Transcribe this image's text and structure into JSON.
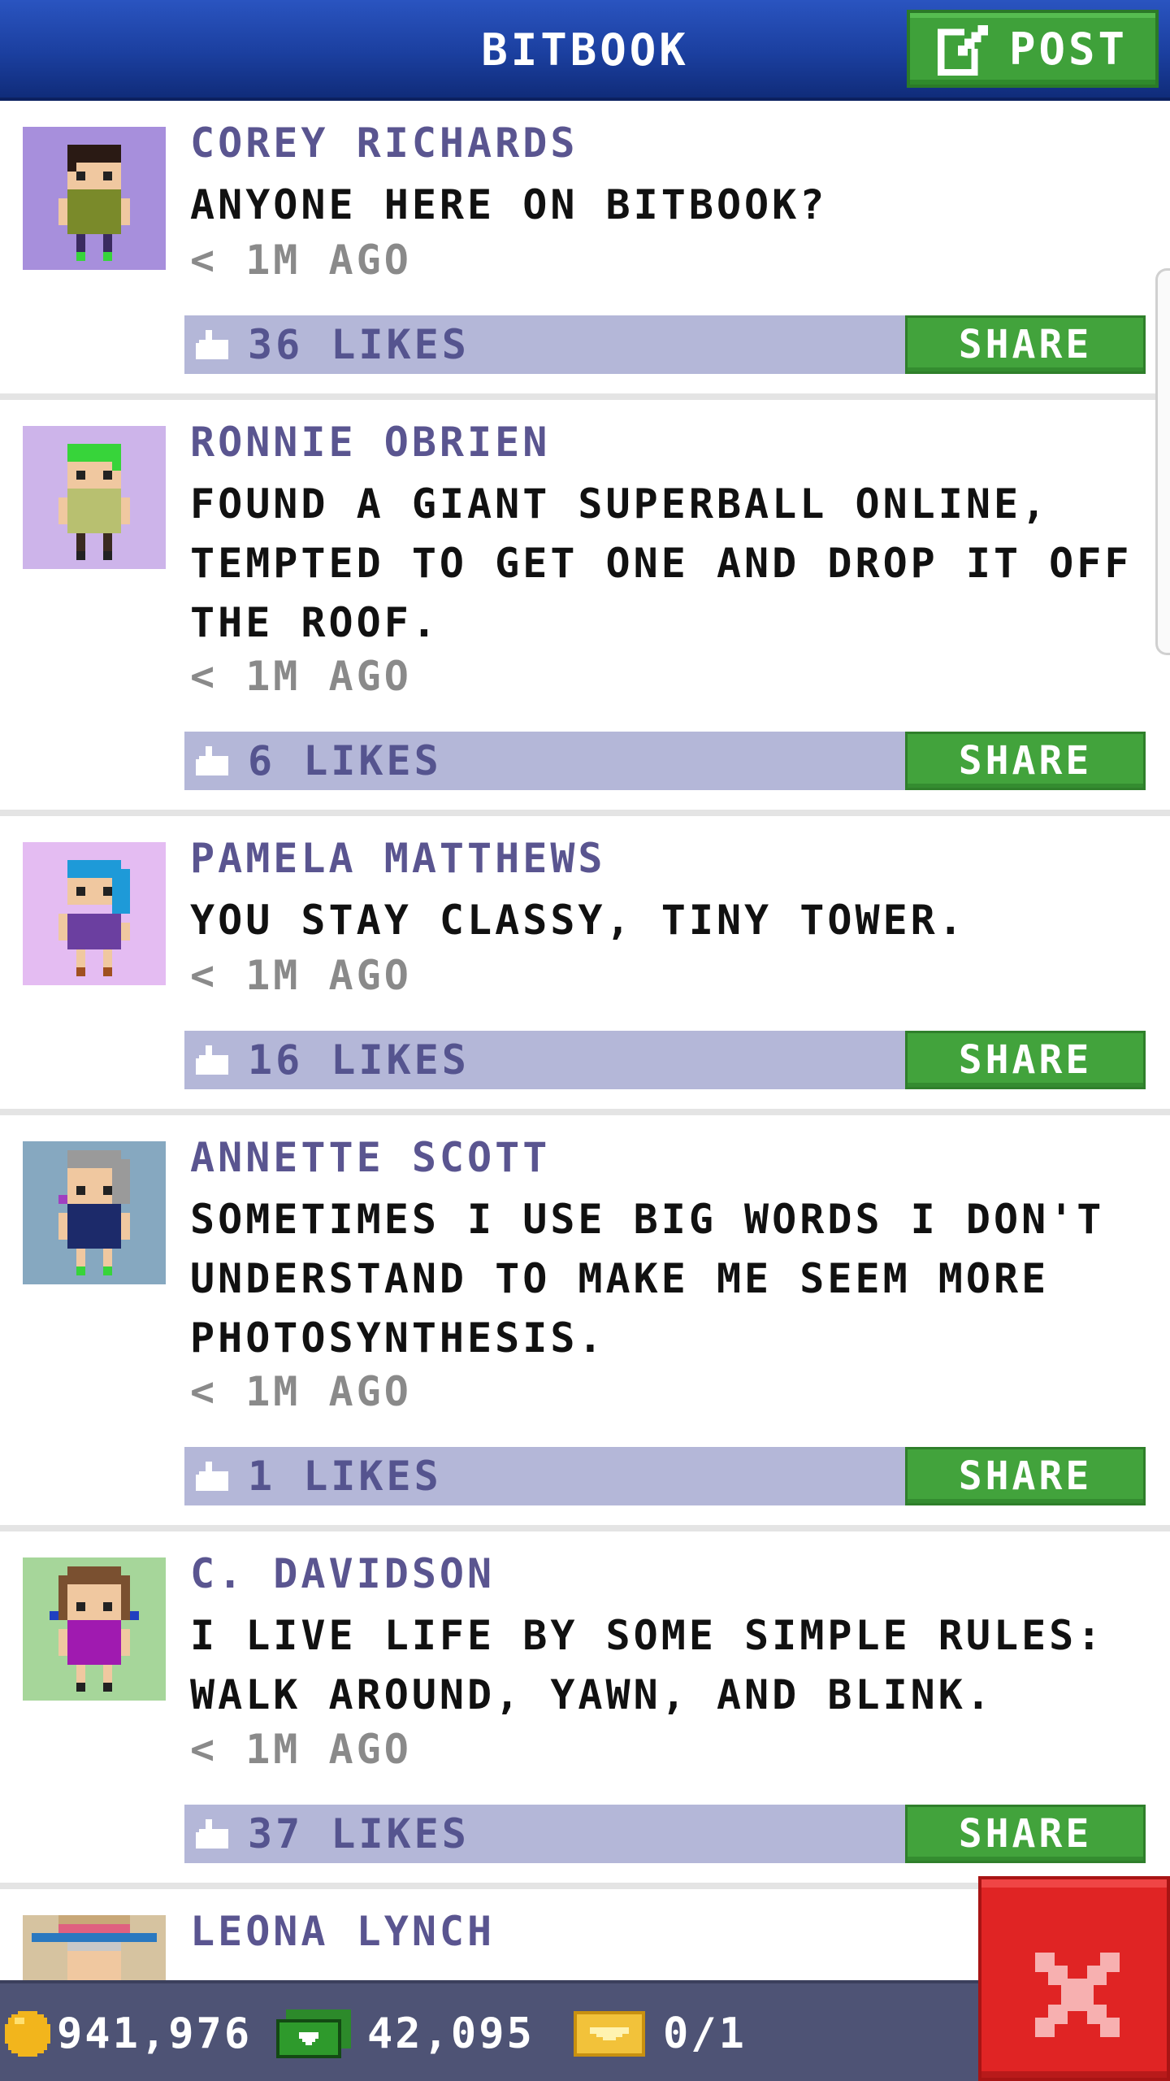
{
  "header": {
    "title": "BITBOOK",
    "post_label": "POST"
  },
  "posts": [
    {
      "author": "COREY RICHARDS",
      "message": "ANYONE HERE ON BITBOOK?",
      "time": "< 1M AGO",
      "likes": "36 LIKES",
      "share_label": "SHARE",
      "avatar_bg": "#a78fdc",
      "hair": "#2a1a14",
      "shirt": "#7a8a2a"
    },
    {
      "author": "RONNIE OBRIEN",
      "message": "FOUND A GIANT SUPERBALL ONLINE, TEMPTED TO GET ONE AND DROP IT OFF THE ROOF.",
      "time": "< 1M AGO",
      "likes": "6 LIKES",
      "share_label": "SHARE",
      "avatar_bg": "#cdb4ea",
      "hair": "#37d43a",
      "shirt": "#b8c070"
    },
    {
      "author": "PAMELA MATTHEWS",
      "message": "YOU STAY CLASSY, TINY TOWER.",
      "time": "< 1M AGO",
      "likes": "16 LIKES",
      "share_label": "SHARE",
      "avatar_bg": "#e4bcf2",
      "hair": "#1e9ad8",
      "shirt": "#6b3fa0"
    },
    {
      "author": "ANNETTE SCOTT",
      "message": "SOMETIMES I USE BIG WORDS I DON'T UNDERSTAND TO MAKE ME SEEM MORE PHOTOSYNTHESIS.",
      "time": "< 1M AGO",
      "likes": "1 LIKES",
      "share_label": "SHARE",
      "avatar_bg": "#86a8c0",
      "hair": "#9a9a9a",
      "shirt": "#1c2a6a"
    },
    {
      "author": "C. DAVIDSON",
      "message": "I LIVE LIFE BY SOME SIMPLE RULES: WALK AROUND, YAWN, AND BLINK.",
      "time": "< 1M AGO",
      "likes": "37 LIKES",
      "share_label": "SHARE",
      "avatar_bg": "#a6d69a",
      "hair": "#7a5030",
      "shirt": "#a01ab0"
    },
    {
      "author": "LEONA LYNCH",
      "avatar_bg": "#d6c3a0",
      "hair": "#c8c8c8",
      "shirt": "#3a8fd0"
    }
  ],
  "footer": {
    "coins": "941,976",
    "bux": "42,095",
    "tickets": "0/1"
  },
  "colors": {
    "header_blue": "#1b3f9f",
    "share_green": "#42a33c",
    "likes_bar": "#b4b7d8",
    "author_purple": "#5a5590",
    "close_red": "#e02424"
  },
  "icons": [
    "edit-icon",
    "like-icon",
    "coin-icon",
    "bux-icon",
    "ticket-icon",
    "close-icon"
  ]
}
